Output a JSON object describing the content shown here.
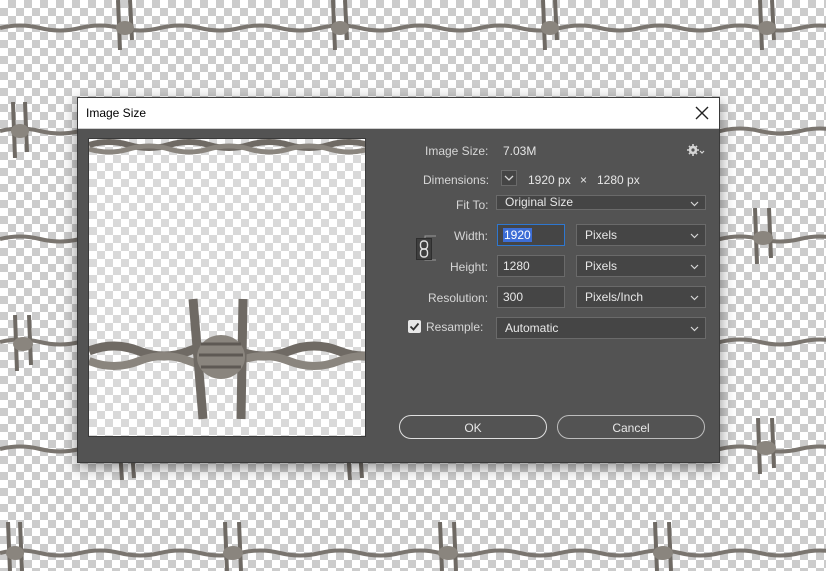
{
  "dialog": {
    "title": "Image Size",
    "image_size_label": "Image Size:",
    "image_size_value": "7.03M",
    "dimensions_label": "Dimensions:",
    "dimensions_width": "1920 px",
    "dimensions_times": "×",
    "dimensions_height": "1280 px",
    "fit_to_label": "Fit To:",
    "fit_to_value": "Original Size",
    "width_label": "Width:",
    "width_value": "1920",
    "width_unit": "Pixels",
    "height_label": "Height:",
    "height_value": "1280",
    "height_unit": "Pixels",
    "resolution_label": "Resolution:",
    "resolution_value": "300",
    "resolution_unit": "Pixels/Inch",
    "resample_label": "Resample:",
    "resample_checked": true,
    "resample_value": "Automatic",
    "ok_label": "OK",
    "cancel_label": "Cancel"
  },
  "icons": {
    "close": "close-icon",
    "settings": "gear-icon",
    "link": "chain-link-icon",
    "dropdown": "chevron-down-icon",
    "checkbox": "checkmark-icon"
  },
  "colors": {
    "dialog_bg": "#535353",
    "field_bg": "#454545",
    "selection": "#3d6ed6",
    "wire": "#7a756f"
  }
}
